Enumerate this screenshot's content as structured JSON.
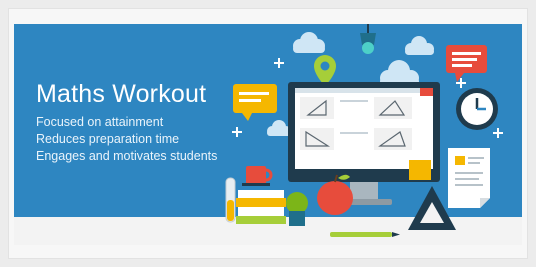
{
  "banner": {
    "title": "Maths Workout",
    "features": [
      "Focused on attainment",
      "Reduces preparation time",
      "Engages and motivates students"
    ]
  },
  "colors": {
    "banner_blue": "#2e86c1",
    "accent_red": "#e74c3c",
    "accent_yellow": "#f5b700",
    "accent_green": "#a6ce39",
    "dark_navy": "#1f3b4d"
  },
  "icons": [
    "cloud-icon",
    "lightbulb-icon",
    "map-pin-icon",
    "speech-bubble-icon",
    "chat-bubble-icon",
    "clock-icon",
    "sparkle-icon",
    "document-icon",
    "apple-icon",
    "potted-plant-icon",
    "coffee-mug-icon",
    "set-square-icon",
    "pencil-icon",
    "books-icon",
    "test-tube-icon"
  ]
}
